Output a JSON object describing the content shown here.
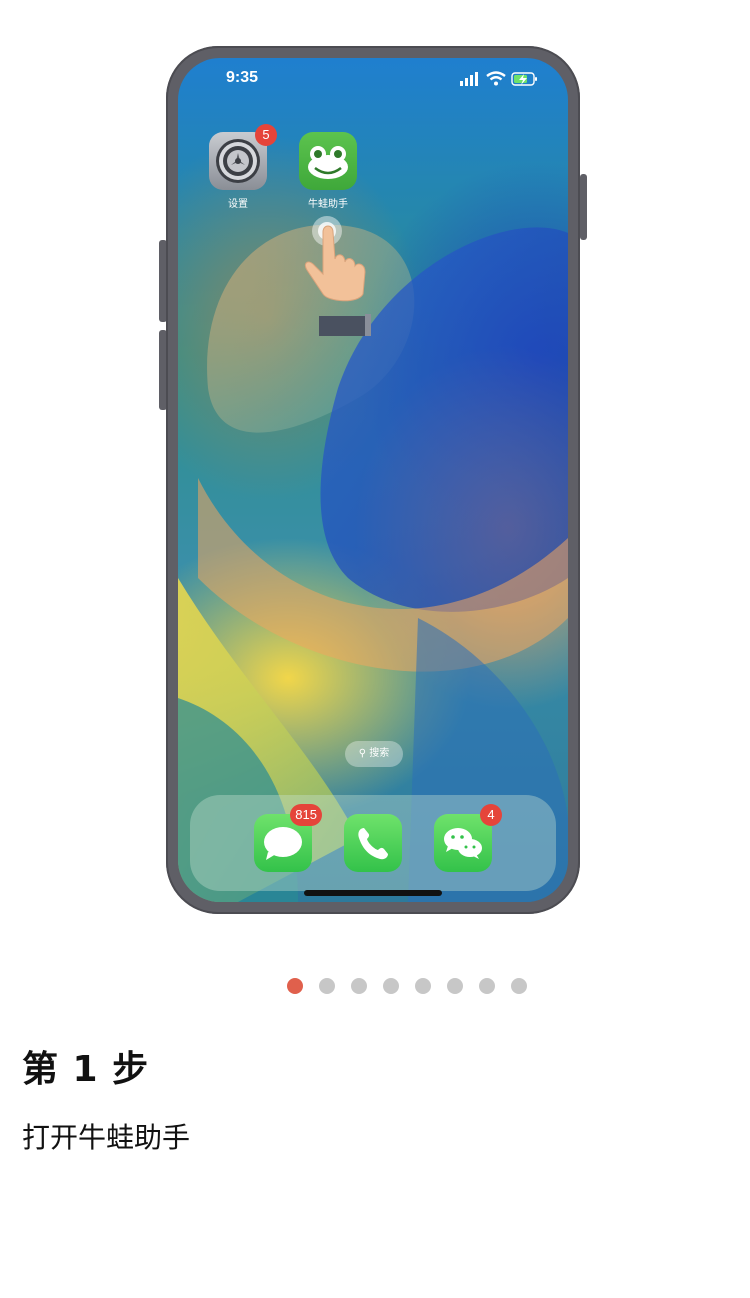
{
  "status_bar": {
    "time": "9:35",
    "icons": [
      "signal-icon",
      "wifi-icon",
      "battery-charging-icon"
    ]
  },
  "home_apps": [
    {
      "label": "设置",
      "icon": "settings-gear-icon",
      "badge": "5"
    },
    {
      "label": "牛蛙助手",
      "icon": "frog-icon",
      "badge": ""
    }
  ],
  "search": {
    "label": "搜索"
  },
  "dock": [
    {
      "icon": "messages-icon",
      "badge": "815"
    },
    {
      "icon": "phone-icon",
      "badge": ""
    },
    {
      "icon": "wechat-icon",
      "badge": "4"
    }
  ],
  "pager": {
    "total": 8,
    "active_index": 0
  },
  "step": {
    "title": "第 1 步",
    "description": "打开牛蛙助手"
  },
  "colors": {
    "accent_dot": "#e0604c",
    "badge": "#e5443a",
    "app_green": "#3fa83a",
    "phone_frame": "#5f5f66"
  }
}
